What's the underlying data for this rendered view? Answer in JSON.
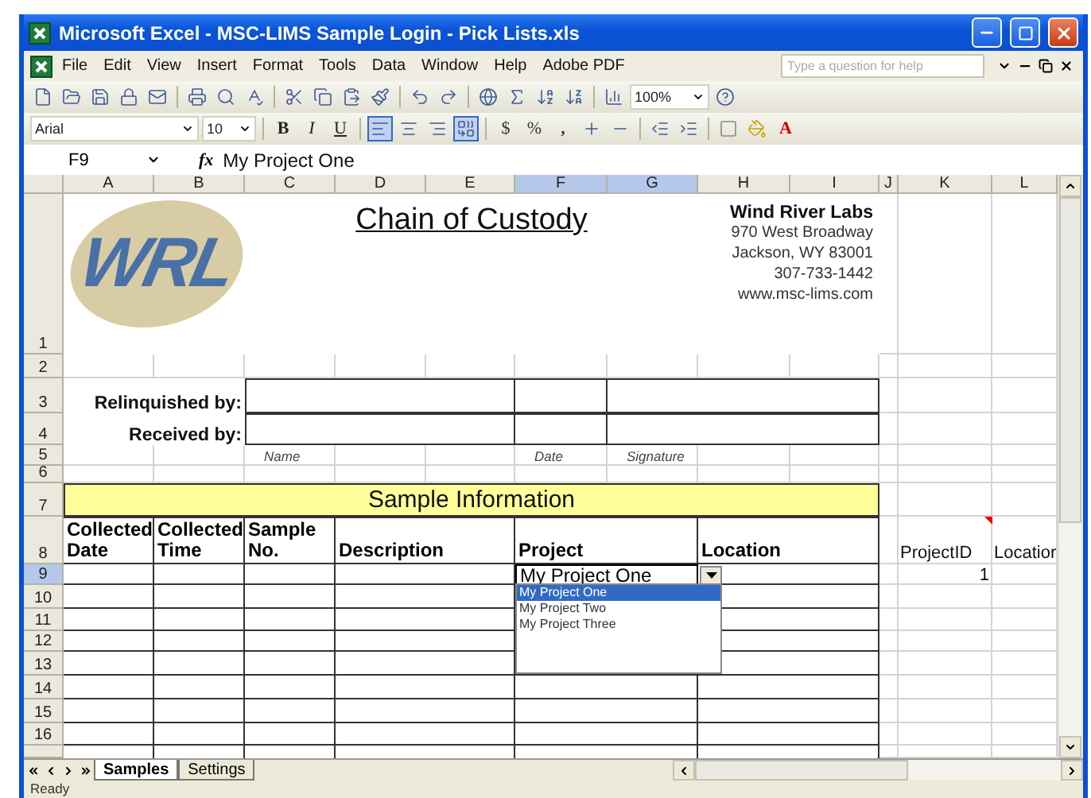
{
  "window": {
    "title": "Microsoft Excel - MSC-LIMS Sample Login - Pick Lists.xls"
  },
  "menu": [
    "File",
    "Edit",
    "View",
    "Insert",
    "Format",
    "Tools",
    "Data",
    "Window",
    "Help",
    "Adobe PDF"
  ],
  "help_box": {
    "placeholder": "Type a question for help"
  },
  "standard_toolbar": {
    "zoom": "100%"
  },
  "formatting_toolbar": {
    "font": "Arial",
    "size": "10",
    "bold": "B",
    "italic": "I",
    "underline": "U",
    "alignment_buttons": [
      {
        "selected": true
      },
      {
        "selected": false
      },
      {
        "selected": false
      }
    ],
    "merge_and_center": true,
    "currency": "$",
    "percent": "%",
    "comma": ",",
    "font_color": "A"
  },
  "formula_bar": {
    "name_box": "F9",
    "fx": "fx",
    "value": "My Project One"
  },
  "columns": [
    {
      "label": "A",
      "selected": false
    },
    {
      "label": "B",
      "selected": false
    },
    {
      "label": "C",
      "selected": false
    },
    {
      "label": "D",
      "selected": false
    },
    {
      "label": "E",
      "selected": false
    },
    {
      "label": "F",
      "selected": true
    },
    {
      "label": "G",
      "selected": true
    },
    {
      "label": "H",
      "selected": false
    },
    {
      "label": "I",
      "selected": false
    },
    {
      "label": "J",
      "selected": false
    },
    {
      "label": "K",
      "selected": false
    },
    {
      "label": "L",
      "selected": false
    }
  ],
  "rows": [
    {
      "label": "1",
      "selected": false
    },
    {
      "label": "2",
      "selected": false
    },
    {
      "label": "3",
      "selected": false
    },
    {
      "label": "4",
      "selected": false
    },
    {
      "label": "5",
      "selected": false
    },
    {
      "label": "6",
      "selected": false
    },
    {
      "label": "7",
      "selected": false
    },
    {
      "label": "8",
      "selected": false
    },
    {
      "label": "9",
      "selected": true
    },
    {
      "label": "10",
      "selected": false
    },
    {
      "label": "11",
      "selected": false
    },
    {
      "label": "12",
      "selected": false
    },
    {
      "label": "13",
      "selected": false
    },
    {
      "label": "14",
      "selected": false
    },
    {
      "label": "15",
      "selected": false
    },
    {
      "label": "16",
      "selected": false
    }
  ],
  "sheet": {
    "logo": "WRL",
    "title": "Chain of Custody",
    "company": {
      "name": "Wind River Labs",
      "lines": [
        "970 West Broadway",
        "Jackson, WY 83001",
        "307-733-1442",
        "www.msc-lims.com"
      ]
    },
    "signoff_labels": [
      "Relinquished by:",
      "Received by:"
    ],
    "signoff_captions": [
      "Name",
      "Date",
      "Signature"
    ],
    "section_title": "Sample Information",
    "table_headers": [
      "Collected Date",
      "Collected Time",
      "Sample No.",
      "Description",
      "Project",
      "Location"
    ],
    "active_cell": {
      "value": "My Project One"
    },
    "dropdown": {
      "options": [
        {
          "label": "My Project One",
          "selected": true
        },
        {
          "label": "My Project Two",
          "selected": false
        },
        {
          "label": "My Project Three",
          "selected": false
        }
      ]
    },
    "lookup": {
      "headers": [
        {
          "label": "ProjectID",
          "comment": true
        },
        {
          "label": "Locatior",
          "comment": false
        }
      ],
      "values": [
        "1"
      ]
    }
  },
  "sheet_tabs": [
    {
      "label": "Samples",
      "selected": true
    },
    {
      "label": "Settings",
      "selected": false
    }
  ],
  "status_bar": "Ready"
}
